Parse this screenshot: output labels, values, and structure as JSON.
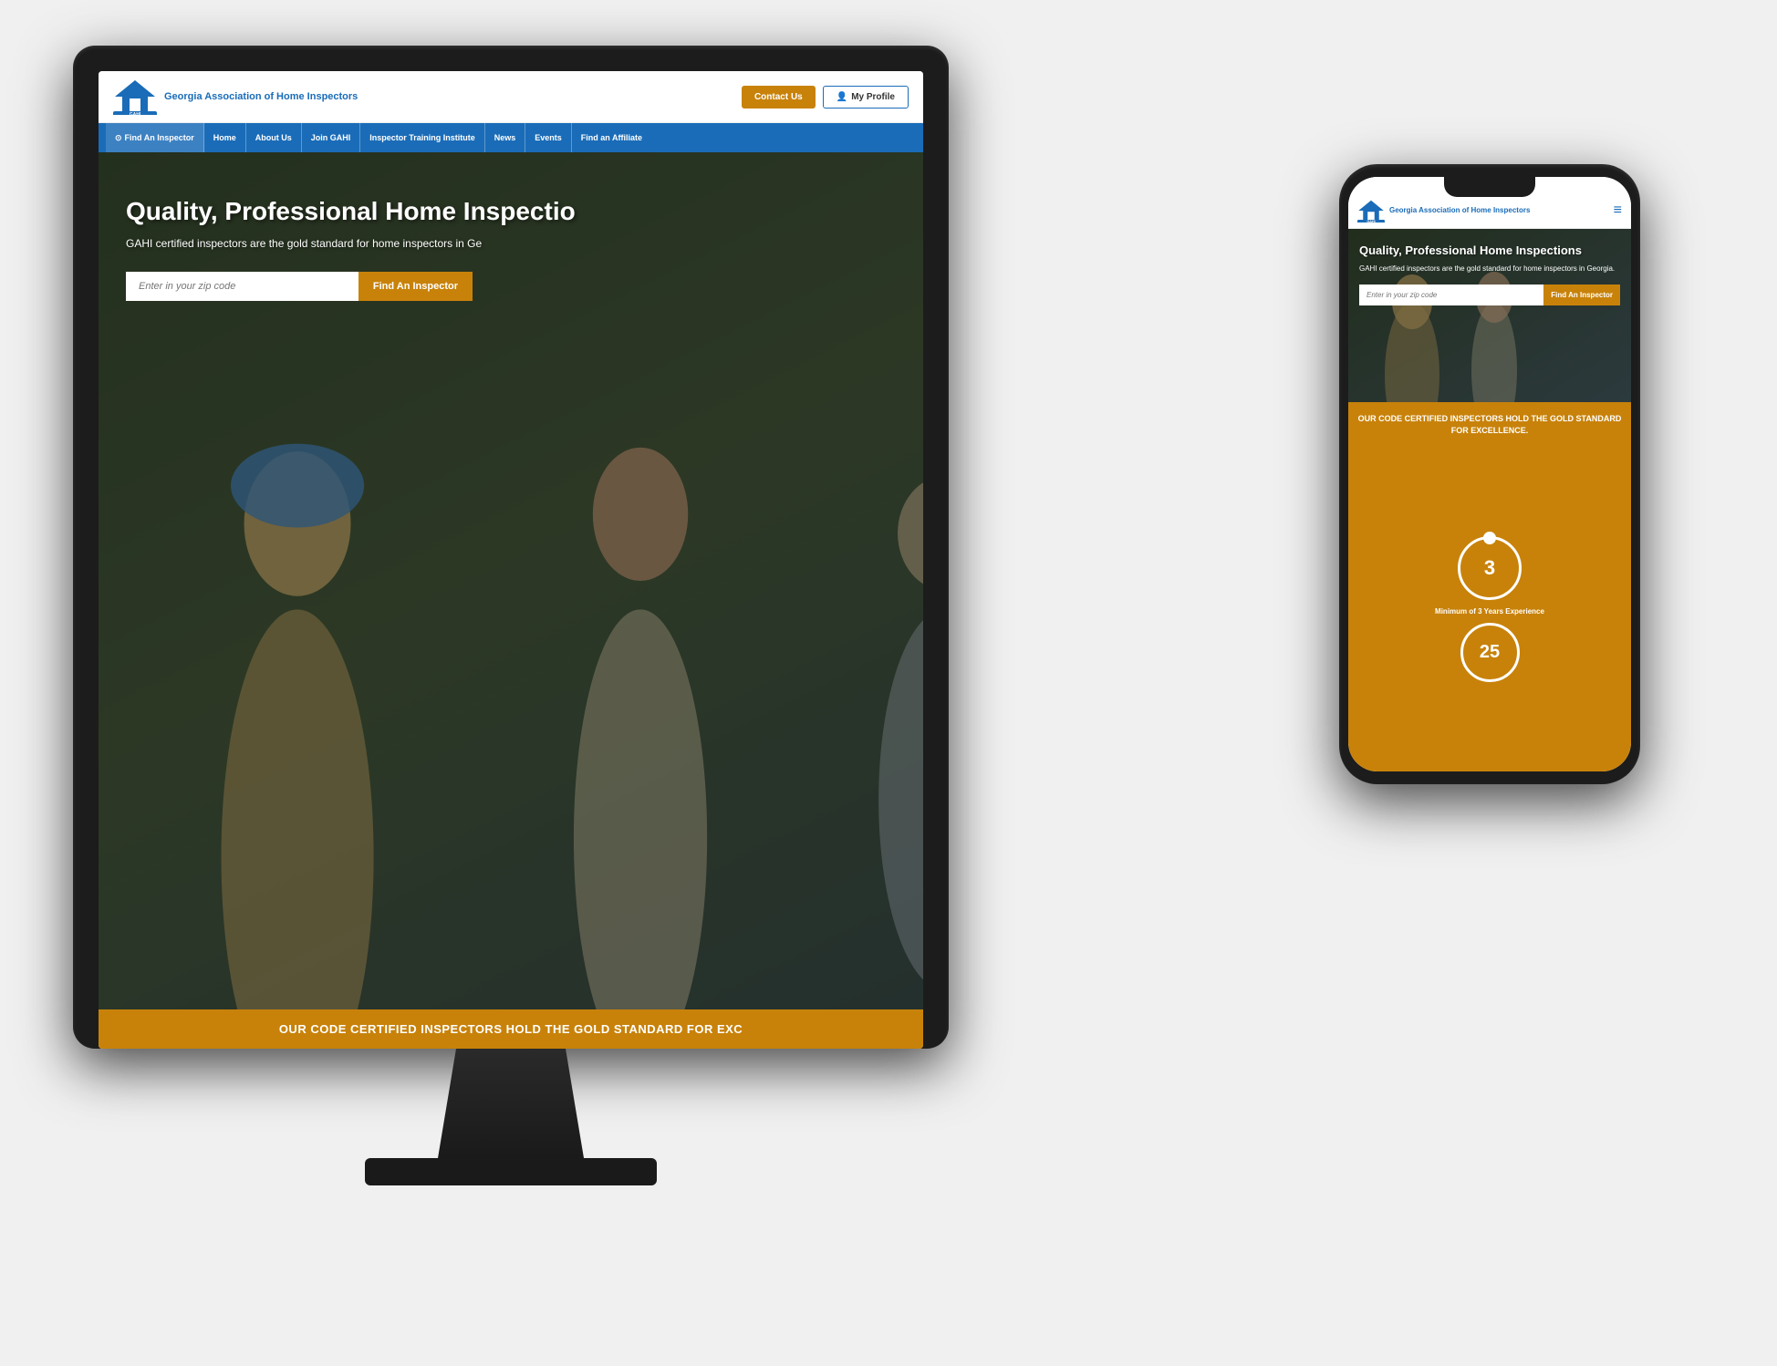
{
  "scene": {
    "bg_color": "#1a1a1a"
  },
  "desktop": {
    "header": {
      "logo_name": "Georgia Association of Home Inspectors",
      "logo_abbr": "GAHI",
      "btn_contact": "Contact Us",
      "btn_profile": "My Profile"
    },
    "nav": {
      "items": [
        {
          "label": "Find An Inspector",
          "icon": "search-icon"
        },
        {
          "label": "Home"
        },
        {
          "label": "About Us"
        },
        {
          "label": "Join GAHI"
        },
        {
          "label": "Inspector Training Institute"
        },
        {
          "label": "News"
        },
        {
          "label": "Events"
        },
        {
          "label": "Find an Affiliate"
        }
      ]
    },
    "hero": {
      "title": "Quality, Professional Home Inspectio",
      "subtitle": "GAHI certified inspectors are the gold standard for home inspectors in Ge",
      "zip_placeholder": "Enter in your zip code",
      "find_btn": "Find An Inspector"
    },
    "banner": {
      "text": "OUR CODE CERTIFIED INSPECTORS HOLD THE GOLD STANDARD FOR EXC"
    }
  },
  "mobile": {
    "header": {
      "logo_name": "Georgia Association of Home Inspectors",
      "logo_abbr": "GAHI",
      "hamburger": "≡"
    },
    "hero": {
      "title": "Quality, Professional Home Inspections",
      "subtitle": "GAHI certified inspectors are the gold standard for home inspectors in Georgia.",
      "zip_placeholder": "Enter in your zip code",
      "find_btn": "Find An Inspector"
    },
    "banner": {
      "text": "OUR CODE CERTIFIED INSPECTORS HOLD THE GOLD STANDARD FOR EXCELLENCE."
    },
    "stats": [
      {
        "number": "3",
        "label": "Minimum of 3 Years Experience",
        "icon": "timer-icon"
      },
      {
        "number": "25",
        "label": "",
        "icon": "timer-icon-2"
      }
    ]
  },
  "colors": {
    "blue": "#1a6cb8",
    "orange": "#c8820a",
    "white": "#ffffff",
    "dark": "#1c1c1c"
  }
}
